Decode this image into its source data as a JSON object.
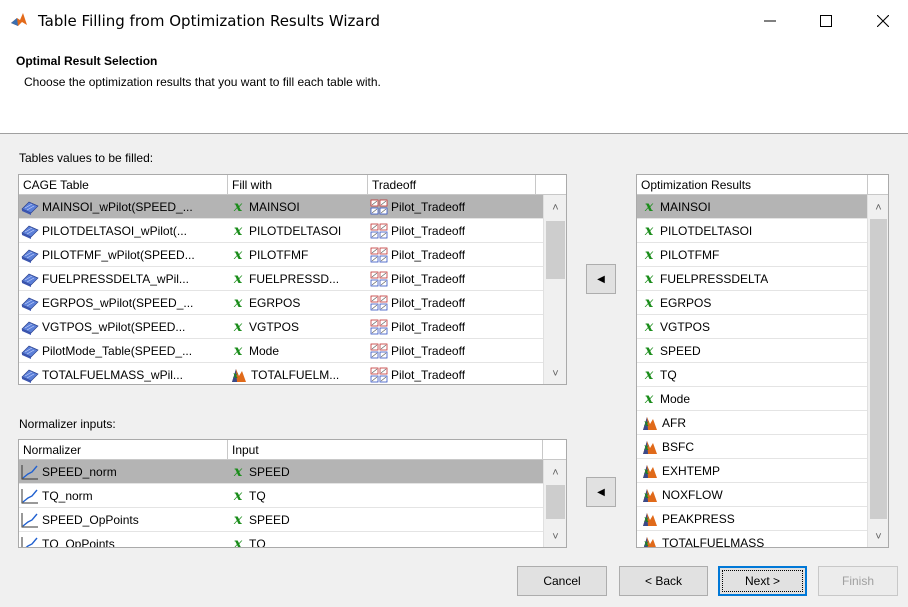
{
  "window": {
    "title": "Table Filling from Optimization Results Wizard",
    "controls": {
      "minimize": "—",
      "maximize": "☐",
      "close": "✕"
    }
  },
  "header": {
    "title": "Optimal Result Selection",
    "subtitle": "Choose the optimization results that you want to fill each table with."
  },
  "tables_section": {
    "label": "Tables values to be filled:",
    "columns": [
      "CAGE Table",
      "Fill with",
      "Tradeoff"
    ],
    "rows": [
      {
        "table": "MAINSOI_wPilot(SPEED_...",
        "fill": "MAINSOI",
        "fill_icon": "x-variable-icon",
        "tradeoff": "Pilot_Tradeoff",
        "selected": true
      },
      {
        "table": "PILOTDELTASOI_wPilot(...",
        "fill": "PILOTDELTASOI",
        "fill_icon": "x-variable-icon",
        "tradeoff": "Pilot_Tradeoff",
        "selected": false
      },
      {
        "table": "PILOTFMF_wPilot(SPEED...",
        "fill": "PILOTFMF",
        "fill_icon": "x-variable-icon",
        "tradeoff": "Pilot_Tradeoff",
        "selected": false
      },
      {
        "table": "FUELPRESSDELTA_wPil...",
        "fill": "FUELPRESSD...",
        "fill_icon": "x-variable-icon",
        "tradeoff": "Pilot_Tradeoff",
        "selected": false
      },
      {
        "table": "EGRPOS_wPilot(SPEED_...",
        "fill": "EGRPOS",
        "fill_icon": "x-variable-icon",
        "tradeoff": "Pilot_Tradeoff",
        "selected": false
      },
      {
        "table": "VGTPOS_wPilot(SPEED...",
        "fill": "VGTPOS",
        "fill_icon": "x-variable-icon",
        "tradeoff": "Pilot_Tradeoff",
        "selected": false
      },
      {
        "table": "PilotMode_Table(SPEED_...",
        "fill": "Mode",
        "fill_icon": "x-variable-icon",
        "tradeoff": "Pilot_Tradeoff",
        "selected": false
      },
      {
        "table": "TOTALFUELMASS_wPil...",
        "fill": "TOTALFUELM...",
        "fill_icon": "model-icon",
        "tradeoff": "Pilot_Tradeoff",
        "selected": false
      }
    ]
  },
  "normalizer_section": {
    "label": "Normalizer inputs:",
    "columns": [
      "Normalizer",
      "Input"
    ],
    "rows": [
      {
        "normalizer": "SPEED_norm",
        "input": "SPEED",
        "selected": true
      },
      {
        "normalizer": "TQ_norm",
        "input": "TQ",
        "selected": false
      },
      {
        "normalizer": "SPEED_OpPoints",
        "input": "SPEED",
        "selected": false
      },
      {
        "normalizer": "TQ_OpPoints",
        "input": "TQ",
        "selected": false
      }
    ]
  },
  "results_section": {
    "column": "Optimization Results",
    "items": [
      {
        "label": "MAINSOI",
        "icon": "x-variable-icon",
        "selected": true
      },
      {
        "label": "PILOTDELTASOI",
        "icon": "x-variable-icon",
        "selected": false
      },
      {
        "label": "PILOTFMF",
        "icon": "x-variable-icon",
        "selected": false
      },
      {
        "label": "FUELPRESSDELTA",
        "icon": "x-variable-icon",
        "selected": false
      },
      {
        "label": "EGRPOS",
        "icon": "x-variable-icon",
        "selected": false
      },
      {
        "label": "VGTPOS",
        "icon": "x-variable-icon",
        "selected": false
      },
      {
        "label": "SPEED",
        "icon": "x-variable-icon",
        "selected": false
      },
      {
        "label": "TQ",
        "icon": "x-variable-icon",
        "selected": false
      },
      {
        "label": "Mode",
        "icon": "x-variable-icon",
        "selected": false
      },
      {
        "label": "AFR",
        "icon": "model-icon",
        "selected": false
      },
      {
        "label": "BSFC",
        "icon": "model-icon",
        "selected": false
      },
      {
        "label": "EXHTEMP",
        "icon": "model-icon",
        "selected": false
      },
      {
        "label": "NOXFLOW",
        "icon": "model-icon",
        "selected": false
      },
      {
        "label": "PEAKPRESS",
        "icon": "model-icon",
        "selected": false
      },
      {
        "label": "TOTALFUELMASS",
        "icon": "model-icon",
        "selected": false
      }
    ]
  },
  "transfer": {
    "assign_glyph": "◀"
  },
  "scroll": {
    "up": "˄",
    "down": "˅"
  },
  "buttons": {
    "cancel": "Cancel",
    "back": "< Back",
    "next": "Next >",
    "finish": "Finish"
  },
  "colors": {
    "selection": "#b4b4b4",
    "x_icon": "#1a8c1a",
    "focus": "#0078d7"
  }
}
